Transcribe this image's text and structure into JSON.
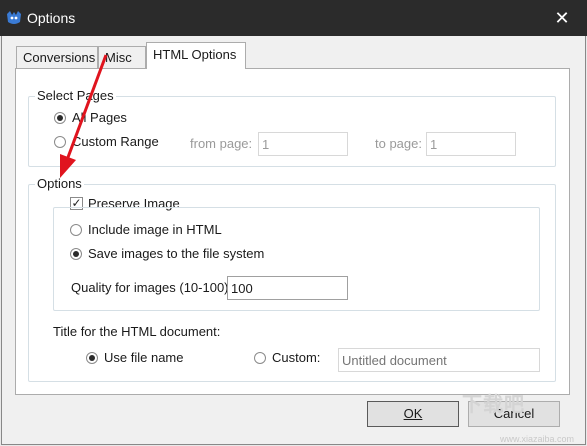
{
  "window": {
    "title": "Options",
    "close_glyph": "✕"
  },
  "tabs": [
    {
      "label": "Conversions"
    },
    {
      "label": "Misc"
    },
    {
      "label": "HTML Options",
      "active": true
    }
  ],
  "select_pages": {
    "group_label": "Select Pages",
    "all_pages": "All Pages",
    "custom_range": "Custom Range",
    "from_label": "from page:",
    "from_value": "1",
    "to_label": "to page:",
    "to_value": "1"
  },
  "options": {
    "group_label": "Options",
    "preserve_image": "Preserve Image",
    "include_image": "Include image in HTML",
    "save_images": "Save images to the file system",
    "quality_label": "Quality for images (10-100)",
    "quality_value": "100",
    "title_label": "Title for the HTML document:",
    "use_file_name": "Use file name",
    "custom_label": "Custom:",
    "custom_placeholder": "Untitled document"
  },
  "buttons": {
    "ok": "OK",
    "cancel": "Cancel"
  },
  "watermark": {
    "text": "下载吧",
    "url": "www.xiazaiba.com"
  },
  "colors": {
    "titlebar": "#2b2b2b",
    "arrow": "#e0141e",
    "app_icon": "#3a7bd5"
  }
}
